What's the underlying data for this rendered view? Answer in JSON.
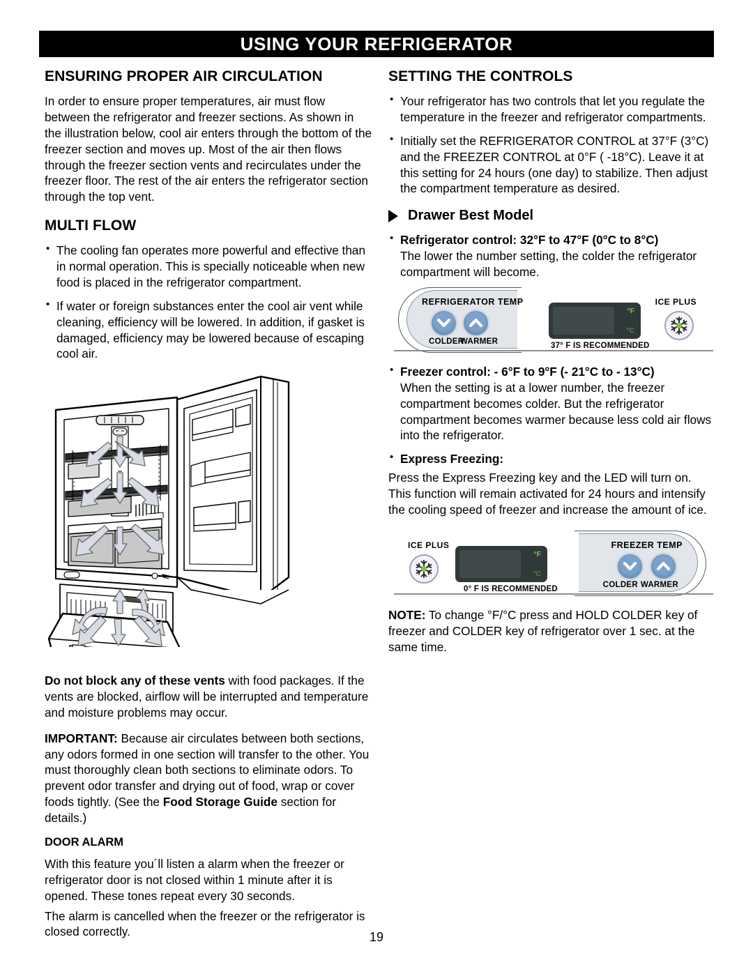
{
  "header": {
    "title": "USING YOUR REFRIGERATOR"
  },
  "left": {
    "section1_title": "ENSURING PROPER AIR CIRCULATION",
    "section1_para": "In order to ensure proper temperatures, air must flow between the refrigerator and freezer sections. As shown in the illustration below, cool air enters through the bottom of the freezer section and moves up. Most of the air then flows through the freezer section vents and recirculates under the freezer floor. The rest of the air enters the refrigerator section through the top vent.",
    "section2_title": "MULTI FLOW",
    "bullets": [
      "The cooling fan operates more powerful and effective than in normal operation. This is specially noticeable when new food is placed in the refrigerator compartment.",
      "If water or foreign substances enter the cool air vent while cleaning, efficiency will be lowered. In addition, if gasket is damaged, efficiency may be lowered because of escaping cool air."
    ],
    "vents_bold": "Do not block any of these vents",
    "vents_rest": " with food packages. If the vents are blocked, airflow will be interrupted and temperature and moisture problems may occur.",
    "important_bold": "IMPORTANT:",
    "important_rest": " Because air circulates between both sections, any odors formed in one section will transfer to the other. You must thoroughly clean both sections to eliminate odors. To prevent odor transfer and drying out of food, wrap or cover foods tightly. (See the ",
    "important_bold2": "Food Storage Guide",
    "important_tail": " section for details.)",
    "door_alarm_title": "DOOR ALARM",
    "door_alarm_para1": "With this feature you´ll listen a alarm when the freezer or refrigerator door is not closed within 1 minute after it is opened. These tones repeat every 30 seconds.",
    "door_alarm_para2": "The alarm is cancelled when the freezer or the refrigerator is closed correctly."
  },
  "right": {
    "section_title": "SETTING THE CONTROLS",
    "bullets": [
      "Your refrigerator has two controls that let you regulate the temperature in the freezer and refrigerator compartments.",
      "Initially set the REFRIGERATOR CONTROL at 37°F (3°C) and the FREEZER CONTROL at 0°F ( -18°C). Leave it at this setting for 24 hours (one day) to stabilize. Then adjust the compartment temperature as desired."
    ],
    "drawer_heading": "Drawer Best Model",
    "fridge_control_bold": "Refrigerator control: 32°F to 47°F (0°C to 8°C)",
    "fridge_control_para": "The lower the number setting, the colder the refrigerator compartment will become.",
    "freezer_control_bold": "Freezer control: - 6°F to 9°F (- 21°C to - 13°C)",
    "freezer_control_para": "When the setting is at a lower number, the freezer compartment becomes colder. But the refrigerator compartment becomes warmer because less cold air flows into the refrigerator.",
    "express_bold": "Express Freezing:",
    "express_para": "Press the Express Freezing key and the LED will turn on. This function will remain activated for 24 hours and intensify the cooling speed of freezer and increase the amount of ice.",
    "note_bold": "NOTE:",
    "note_rest": " To change °F/°C  press and HOLD COLDER key of freezer and COLDER key of refrigerator over 1 sec. at the same time."
  },
  "panel_fridge": {
    "temp_label": "REFRIGERATOR TEMP",
    "colder": "COLDER",
    "warmer": "WARMER",
    "lcd_f": "°F",
    "lcd_c": "°C",
    "recommended": "37° F IS RECOMMENDED",
    "ice_plus": "ICE PLUS"
  },
  "panel_freezer": {
    "temp_label": "FREEZER TEMP",
    "colder": "COLDER",
    "warmer": "WARMER",
    "lcd_f": "°F",
    "lcd_c": "°C",
    "recommended": "0° F IS RECOMMENDED",
    "ice_plus": "ICE PLUS"
  },
  "footer": {
    "page_number": "19"
  },
  "colors": {
    "banner_bg": "#000000",
    "button_blue": "#7ba2cd",
    "panel_gray": "#e2e5ea",
    "lcd_dark": "#30393a",
    "led_green": "#7fc242",
    "arrow_fill": "#d8dce4"
  }
}
